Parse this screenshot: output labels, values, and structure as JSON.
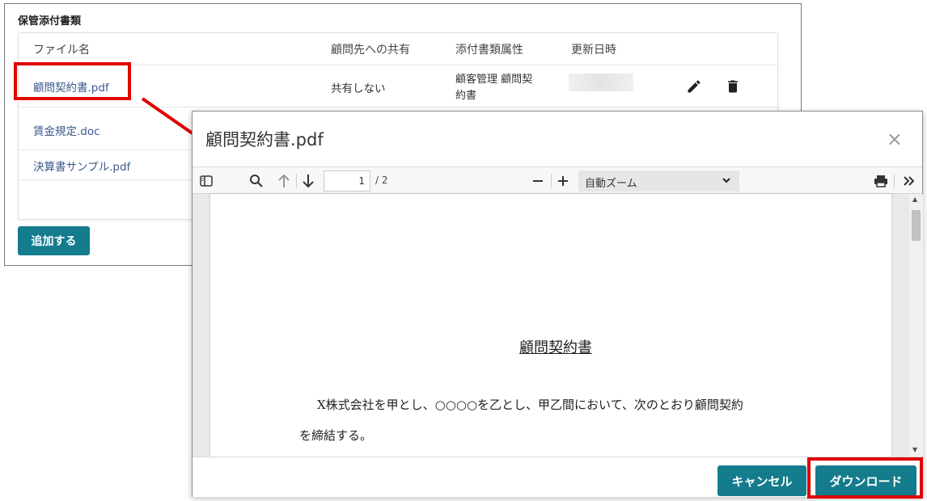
{
  "panel": {
    "title": "保管添付書類",
    "headers": {
      "file_name": "ファイル名",
      "share": "顧問先への共有",
      "attribute": "添付書類属性",
      "updated": "更新日時"
    },
    "rows": [
      {
        "file_name": "顧問契約書.pdf",
        "share": "共有しない",
        "attribute_line1": "顧客管理 顧問契",
        "attribute_line2": "約書"
      },
      {
        "file_name": "賃金規定.doc"
      },
      {
        "file_name": "決算書サンプル.pdf"
      }
    ],
    "add_button": "追加する"
  },
  "modal": {
    "title": "顧問契約書.pdf",
    "close_glyph": "×",
    "toolbar": {
      "page_current": "1",
      "page_total": "/ 2",
      "zoom": "自動ズーム",
      "icons": [
        "sidebar-toggle-icon",
        "search-icon",
        "arrow-up-icon",
        "arrow-down-icon",
        "zoom-out-icon",
        "zoom-in-icon",
        "print-icon",
        "more-tools-icon"
      ]
    },
    "document": {
      "title": "顧問契約書",
      "line1": "X株式会社を甲とし、○○○○を乙とし、甲乙間において、次のとおり顧問契約",
      "line2": "を締結する。"
    },
    "buttons": {
      "cancel": "キャンセル",
      "download": "ダウンロード"
    }
  },
  "colors": {
    "accent": "#147c8c",
    "highlight": "#e00000",
    "link": "#3b5a8c"
  }
}
